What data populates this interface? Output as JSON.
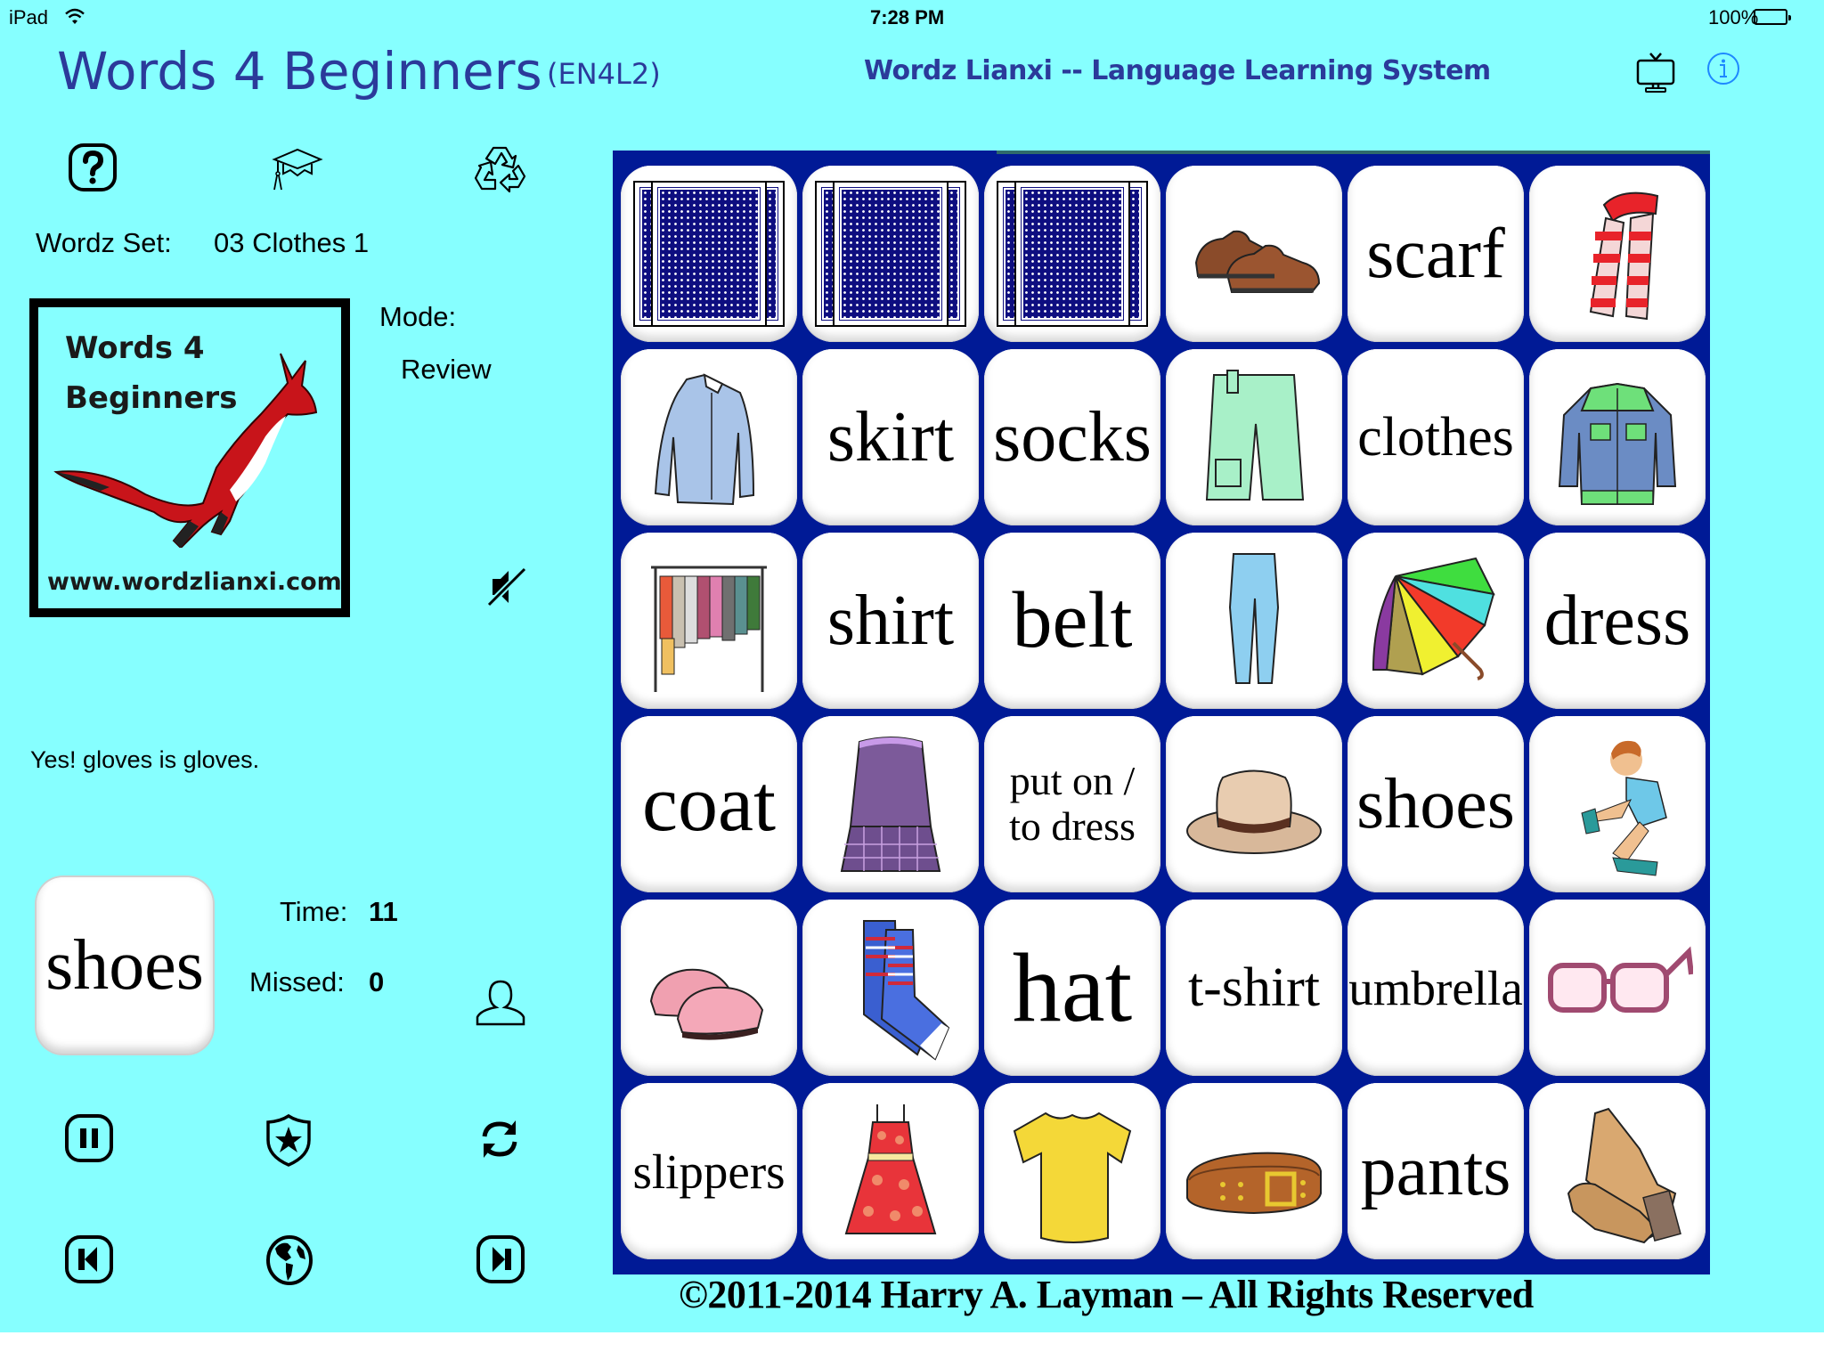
{
  "status_bar": {
    "device": "iPad",
    "time": "7:28 PM",
    "battery": "100%",
    "wifi_icon": "wifi-icon",
    "battery_icon": "battery-icon"
  },
  "header": {
    "title": "Words 4 Beginners",
    "code": "(EN4L2)",
    "subtitle": "Wordz Lianxi -- Language Learning System",
    "tv_icon": "tv-icon",
    "info_icon": "info-icon",
    "accent_color": "#2B3A9A"
  },
  "toolbar_top": [
    {
      "name": "help-icon"
    },
    {
      "name": "graduation-cap-icon"
    },
    {
      "name": "recycle-icon"
    }
  ],
  "wordz_set": {
    "label": "Wordz Set:",
    "value": "03 Clothes 1"
  },
  "logo": {
    "line1": "Words 4",
    "line2": "Beginners",
    "url": "www.wordzlianxi.com"
  },
  "mode": {
    "label": "Mode:",
    "value": "Review"
  },
  "mute_icon": "speaker-muted-icon",
  "feedback": "Yes! gloves is gloves.",
  "current_card": {
    "word": "shoes"
  },
  "stats": {
    "time_label": "Time:",
    "time_value": "11",
    "missed_label": "Missed:",
    "missed_value": "0"
  },
  "user_icon": "user-icon",
  "controls": [
    {
      "name": "pause-icon"
    },
    {
      "name": "shield-star-icon"
    },
    {
      "name": "refresh-icon"
    },
    {
      "name": "skip-back-icon"
    },
    {
      "name": "globe-icon"
    },
    {
      "name": "skip-forward-icon"
    }
  ],
  "board": {
    "background": "#001A96",
    "timer_remaining_fraction": 0.65,
    "columns": 6,
    "rows": 6,
    "tiles": [
      {
        "type": "back"
      },
      {
        "type": "back"
      },
      {
        "type": "back"
      },
      {
        "type": "picture",
        "item": "shoes"
      },
      {
        "type": "word",
        "text": "scarf"
      },
      {
        "type": "picture",
        "item": "scarf"
      },
      {
        "type": "picture",
        "item": "shirt"
      },
      {
        "type": "word",
        "text": "skirt"
      },
      {
        "type": "word",
        "text": "socks"
      },
      {
        "type": "picture",
        "item": "shorts"
      },
      {
        "type": "word",
        "text": "clothes"
      },
      {
        "type": "picture",
        "item": "coat"
      },
      {
        "type": "picture",
        "item": "clothes"
      },
      {
        "type": "word",
        "text": "shirt"
      },
      {
        "type": "word",
        "text": "belt"
      },
      {
        "type": "picture",
        "item": "pants"
      },
      {
        "type": "picture",
        "item": "umbrella"
      },
      {
        "type": "word",
        "text": "dress"
      },
      {
        "type": "word",
        "text": "coat"
      },
      {
        "type": "picture",
        "item": "skirt"
      },
      {
        "type": "word",
        "text": "put on /\nto dress"
      },
      {
        "type": "picture",
        "item": "hat"
      },
      {
        "type": "word",
        "text": "shoes"
      },
      {
        "type": "picture",
        "item": "put on"
      },
      {
        "type": "picture",
        "item": "slippers"
      },
      {
        "type": "picture",
        "item": "socks"
      },
      {
        "type": "word",
        "text": "hat"
      },
      {
        "type": "word",
        "text": "t-shirt"
      },
      {
        "type": "word",
        "text": "umbrella"
      },
      {
        "type": "picture",
        "item": "glasses"
      },
      {
        "type": "word",
        "text": "slippers"
      },
      {
        "type": "picture",
        "item": "dress"
      },
      {
        "type": "picture",
        "item": "t-shirt"
      },
      {
        "type": "picture",
        "item": "belt"
      },
      {
        "type": "word",
        "text": "pants"
      },
      {
        "type": "picture",
        "item": "gloves"
      }
    ]
  },
  "copyright": "©2011-2014 Harry A. Layman – All Rights Reserved"
}
